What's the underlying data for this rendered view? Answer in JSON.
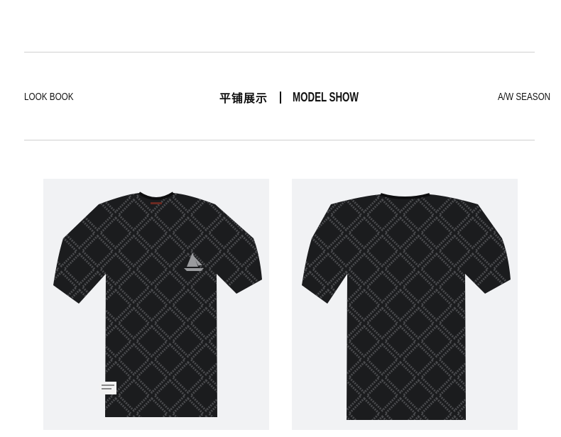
{
  "header": {
    "left_label": "LOOK BOOK",
    "title_cn": "平铺展示",
    "title_en": "MODEL SHOW",
    "right_label": "A/W SEASON"
  },
  "colors": {
    "rule": "#cfcfcf",
    "panel_bg": "#f1f2f4",
    "shirt": "#1b1c1e",
    "pattern": "#4a4b4e"
  },
  "images": [
    {
      "name": "front-view",
      "icons": [
        "sailboat-logo-icon",
        "care-label-icon"
      ]
    },
    {
      "name": "back-view"
    }
  ]
}
